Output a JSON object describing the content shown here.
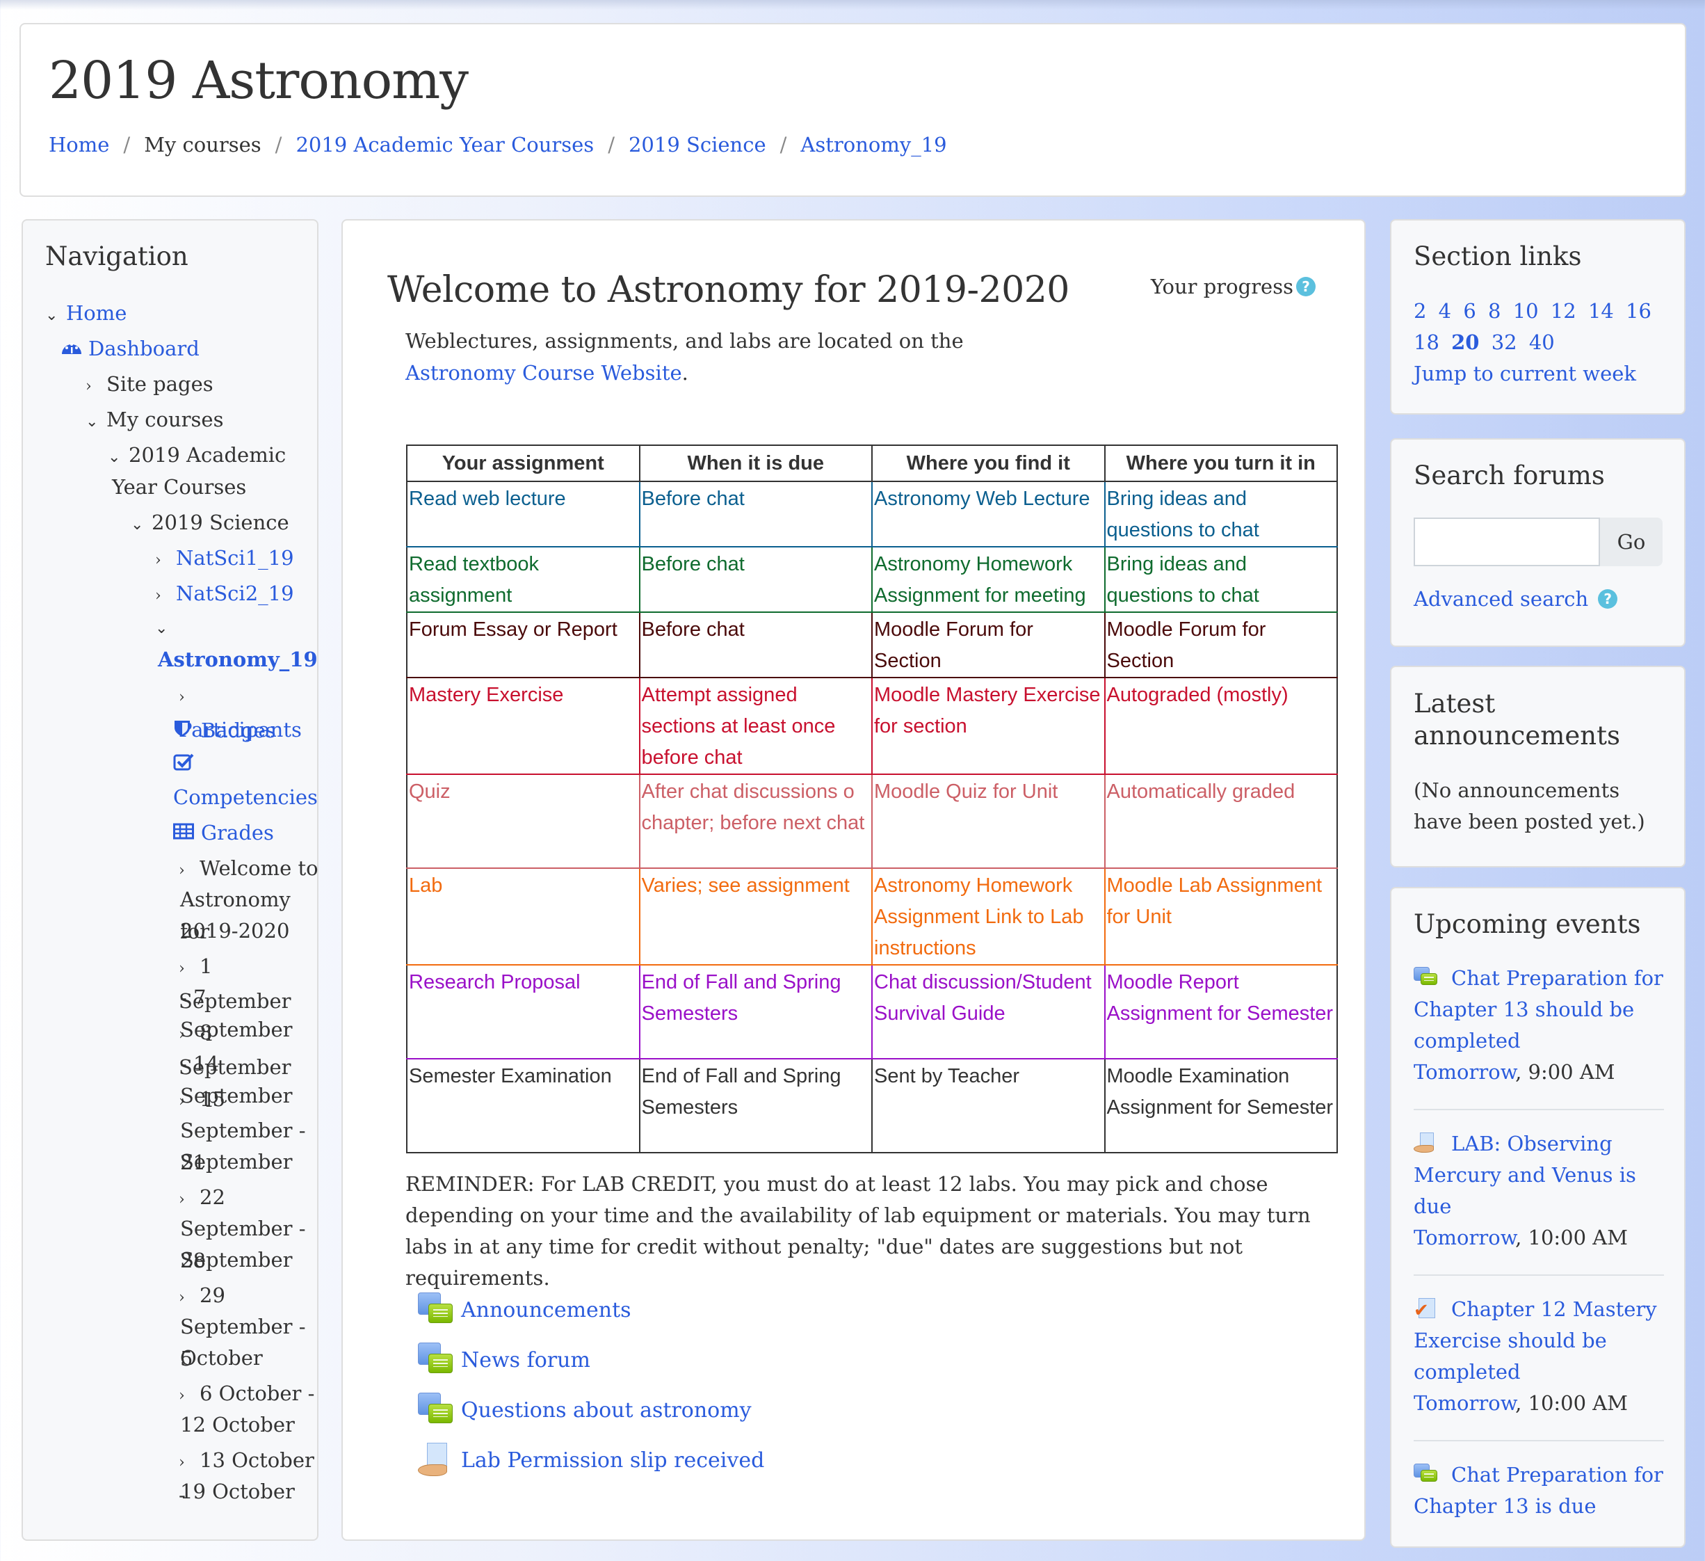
{
  "header": {
    "title": "2019 Astronomy",
    "breadcrumb": [
      {
        "label": "Home",
        "link": true
      },
      {
        "label": "My courses",
        "link": false
      },
      {
        "label": "2019 Academic Year Courses",
        "link": true
      },
      {
        "label": "2019 Science",
        "link": true
      },
      {
        "label": "Astronomy_19",
        "link": true
      }
    ]
  },
  "nav": {
    "title": "Navigation",
    "items": {
      "home": "Home",
      "dashboard": "Dashboard",
      "site_pages": "Site pages",
      "my_courses": "My courses",
      "academic_1": "2019 Academic",
      "academic_2": "Year Courses",
      "science": "2019 Science",
      "natsci1": "NatSci1_19",
      "natsci2": "NatSci2_19",
      "astronomy": "Astronomy_19",
      "participants": "Participants",
      "badges": "Badges",
      "competencies": "Competencies",
      "grades": "Grades",
      "welcome_1": "Welcome to",
      "welcome_2": "Astronomy for",
      "welcome_3": "2019-2020",
      "wk1_1": "1 September",
      "wk1_2": "- 7 September",
      "wk2_1": "8 September",
      "wk2_2": "- 14 September",
      "wk3_1": "15",
      "wk3_2": "September - 21",
      "wk3_3": "September",
      "wk4_1": "22",
      "wk4_2": "September - 28",
      "wk4_3": "September",
      "wk5_1": "29",
      "wk5_2": "September - 5",
      "wk5_3": "October",
      "wk6_1": "6 October -",
      "wk6_2": "12 October",
      "wk7_1": "13 October -",
      "wk7_2": "19 October"
    }
  },
  "main": {
    "section_title": "Welcome to Astronomy for 2019-2020",
    "progress_label": "Your progress",
    "intro_text": "Weblectures, assignments, and labs are located on the",
    "intro_link": "Astronomy Course Website",
    "intro_end": ".",
    "table": {
      "headers": [
        "Your assignment",
        "When it is due",
        "Where you find it",
        "Where you turn it in"
      ],
      "rows": [
        {
          "color": "#0b5f8f",
          "cells": [
            "Read web lecture",
            "Before chat",
            "Astronomy Web Lecture",
            "Bring ideas and questions to chat"
          ]
        },
        {
          "color": "#0f6b2e",
          "cells": [
            "Read textbook assignment",
            "Before chat",
            "Astronomy Homework Assignment for meeting",
            "Bring ideas and questions to chat"
          ]
        },
        {
          "color": "#4a0a0a",
          "cells": [
            "Forum Essay or Report",
            "Before chat",
            "Moodle Forum for Section",
            "Moodle Forum for Section"
          ]
        },
        {
          "color": "#c8102e",
          "cells": [
            "Mastery Exercise",
            "Attempt assigned sections at least once before chat",
            "Moodle Mastery Exercise for section",
            "Autograded (mostly)"
          ]
        },
        {
          "color": "#cc5f66",
          "cells": [
            "Quiz",
            "After chat discussions o chapter; before next chat",
            "Moodle Quiz for Unit",
            "Automatically graded"
          ]
        },
        {
          "color": "#f26b0f",
          "cells": [
            "Lab",
            "Varies; see assignment",
            "Astronomy Homework Assignment Link to Lab instructions",
            "Moodle Lab Assignment for Unit"
          ]
        },
        {
          "color": "#9a10c8",
          "cells": [
            "Research Proposal",
            "End of Fall and Spring Semesters",
            "Chat discussion/Student Survival Guide",
            "Moodle Report Assignment for Semester"
          ]
        },
        {
          "color": "#333333",
          "cells": [
            "Semester Examination",
            "End of Fall and Spring Semesters",
            "Sent by Teacher",
            "Moodle Examination Assignment for Semester"
          ]
        }
      ]
    },
    "reminder": "REMINDER: For LAB CREDIT, you must do at least 12 labs. You may pick and chose depending on your time and the availability of lab equipment or materials. You may turn labs in at any time for credit without penalty; \"due\" dates are suggestions but not requirements.",
    "activities": [
      {
        "label": "Announcements",
        "icon": "forum-icon"
      },
      {
        "label": "News forum",
        "icon": "forum-icon"
      },
      {
        "label": "Questions about astronomy",
        "icon": "forum-icon"
      },
      {
        "label": "Lab Permission slip received",
        "icon": "assignment-icon"
      }
    ]
  },
  "section_links": {
    "title": "Section links",
    "numbers": [
      "2",
      "4",
      "6",
      "8",
      "10",
      "12",
      "14",
      "16",
      "18",
      "20",
      "32",
      "40"
    ],
    "current": "20",
    "jump_label": "Jump to current week"
  },
  "search_forums": {
    "title": "Search forums",
    "input_value": "",
    "go_label": "Go",
    "advanced_label": "Advanced search"
  },
  "latest_announcements": {
    "title_1": "Latest",
    "title_2": "announcements",
    "empty_text": "(No announcements have been posted yet.)"
  },
  "upcoming_events": {
    "title": "Upcoming events",
    "events": [
      {
        "icon": "forum-icon",
        "title": "Chat Preparation for Chapter 13 should be completed",
        "day": "Tomorrow",
        "time": ", 9:00 AM"
      },
      {
        "icon": "assignment-icon",
        "title": "LAB: Observing Mercury and Venus is due",
        "day": "Tomorrow",
        "time": ", 10:00 AM"
      },
      {
        "icon": "quiz-icon",
        "title": "Chapter 12 Mastery Exercise should be completed",
        "day": "Tomorrow",
        "time": ", 10:00 AM"
      },
      {
        "icon": "forum-icon",
        "title": "Chat Preparation for Chapter 13 is due",
        "day": "",
        "time": ""
      }
    ]
  },
  "colors": {
    "link": "#2a5bdc",
    "help": "#5bc0de"
  }
}
